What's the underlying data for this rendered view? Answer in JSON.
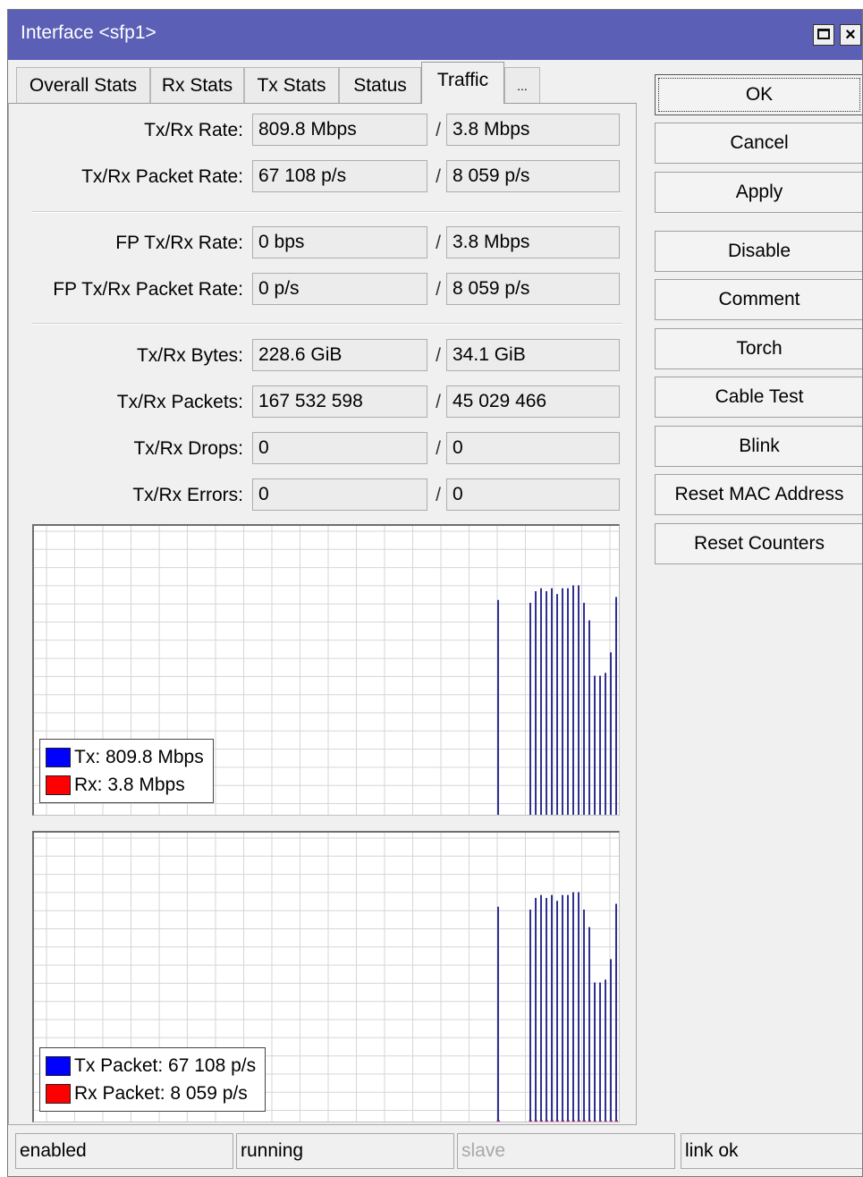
{
  "window": {
    "title": "Interface <sfp1>"
  },
  "tabs": [
    {
      "label": "Overall Stats"
    },
    {
      "label": "Rx Stats"
    },
    {
      "label": "Tx Stats"
    },
    {
      "label": "Status"
    },
    {
      "label": "Traffic",
      "active": true
    },
    {
      "label": "..."
    }
  ],
  "stats": [
    {
      "label": "Tx/Rx Rate:",
      "tx": "809.8 Mbps",
      "rx": "3.8 Mbps"
    },
    {
      "label": "Tx/Rx Packet Rate:",
      "tx": "67 108 p/s",
      "rx": "8 059 p/s"
    },
    {
      "label": "FP Tx/Rx Rate:",
      "tx": "0 bps",
      "rx": "3.8 Mbps"
    },
    {
      "label": "FP Tx/Rx Packet Rate:",
      "tx": "0 p/s",
      "rx": "8 059 p/s"
    },
    {
      "label": "Tx/Rx Bytes:",
      "tx": "228.6 GiB",
      "rx": "34.1 GiB"
    },
    {
      "label": "Tx/Rx Packets:",
      "tx": "167 532 598",
      "rx": "45 029 466"
    },
    {
      "label": "Tx/Rx Drops:",
      "tx": "0",
      "rx": "0"
    },
    {
      "label": "Tx/Rx Errors:",
      "tx": "0",
      "rx": "0"
    }
  ],
  "slash": "/",
  "graphs": {
    "traffic": {
      "tx_legend": "Tx:  809.8 Mbps",
      "rx_legend": "Rx:  3.8 Mbps"
    },
    "packets": {
      "tx_legend": "Tx Packet:  67 108 p/s",
      "rx_legend": "Rx Packet:  8 059 p/s"
    }
  },
  "chart_data": [
    {
      "type": "bar",
      "series": [
        {
          "name": "Tx",
          "color": "#0000ff",
          "values": [
            0.74,
            0.0,
            0.0,
            0.0,
            0.0,
            0.0,
            0.73,
            0.77,
            0.78,
            0.77,
            0.78,
            0.76,
            0.78,
            0.78,
            0.79,
            0.79,
            0.73,
            0.67,
            0.48,
            0.48,
            0.49,
            0.56,
            0.75
          ]
        },
        {
          "name": "Rx",
          "color": "#ff0000",
          "values": [
            0,
            0,
            0,
            0,
            0,
            0,
            0,
            0,
            0,
            0,
            0,
            0,
            0,
            0,
            0,
            0,
            0,
            0,
            0,
            0,
            0,
            0,
            0
          ]
        }
      ]
    },
    {
      "type": "bar",
      "series": [
        {
          "name": "Tx Packet",
          "color": "#0000ff",
          "values": [
            0.74,
            0.0,
            0.0,
            0.0,
            0.0,
            0.0,
            0.73,
            0.77,
            0.78,
            0.77,
            0.78,
            0.76,
            0.78,
            0.78,
            0.79,
            0.79,
            0.73,
            0.67,
            0.48,
            0.48,
            0.49,
            0.56,
            0.75
          ]
        },
        {
          "name": "Rx Packet",
          "color": "#ff0000",
          "values": [
            0.11,
            0.0,
            0.0,
            0.0,
            0.0,
            0.0,
            0.11,
            0.11,
            0.11,
            0.11,
            0.11,
            0.11,
            0.11,
            0.11,
            0.11,
            0.11,
            0.11,
            0.1,
            0.09,
            0.09,
            0.09,
            0.1,
            0.11
          ]
        }
      ]
    }
  ],
  "buttons": [
    "OK",
    "Cancel",
    "Apply",
    "Disable",
    "Comment",
    "Torch",
    "Cable Test",
    "Blink",
    "Reset MAC Address",
    "Reset Counters"
  ],
  "statusbar": {
    "enabled": "enabled",
    "running": "running",
    "slave": "slave",
    "link": "link ok"
  }
}
